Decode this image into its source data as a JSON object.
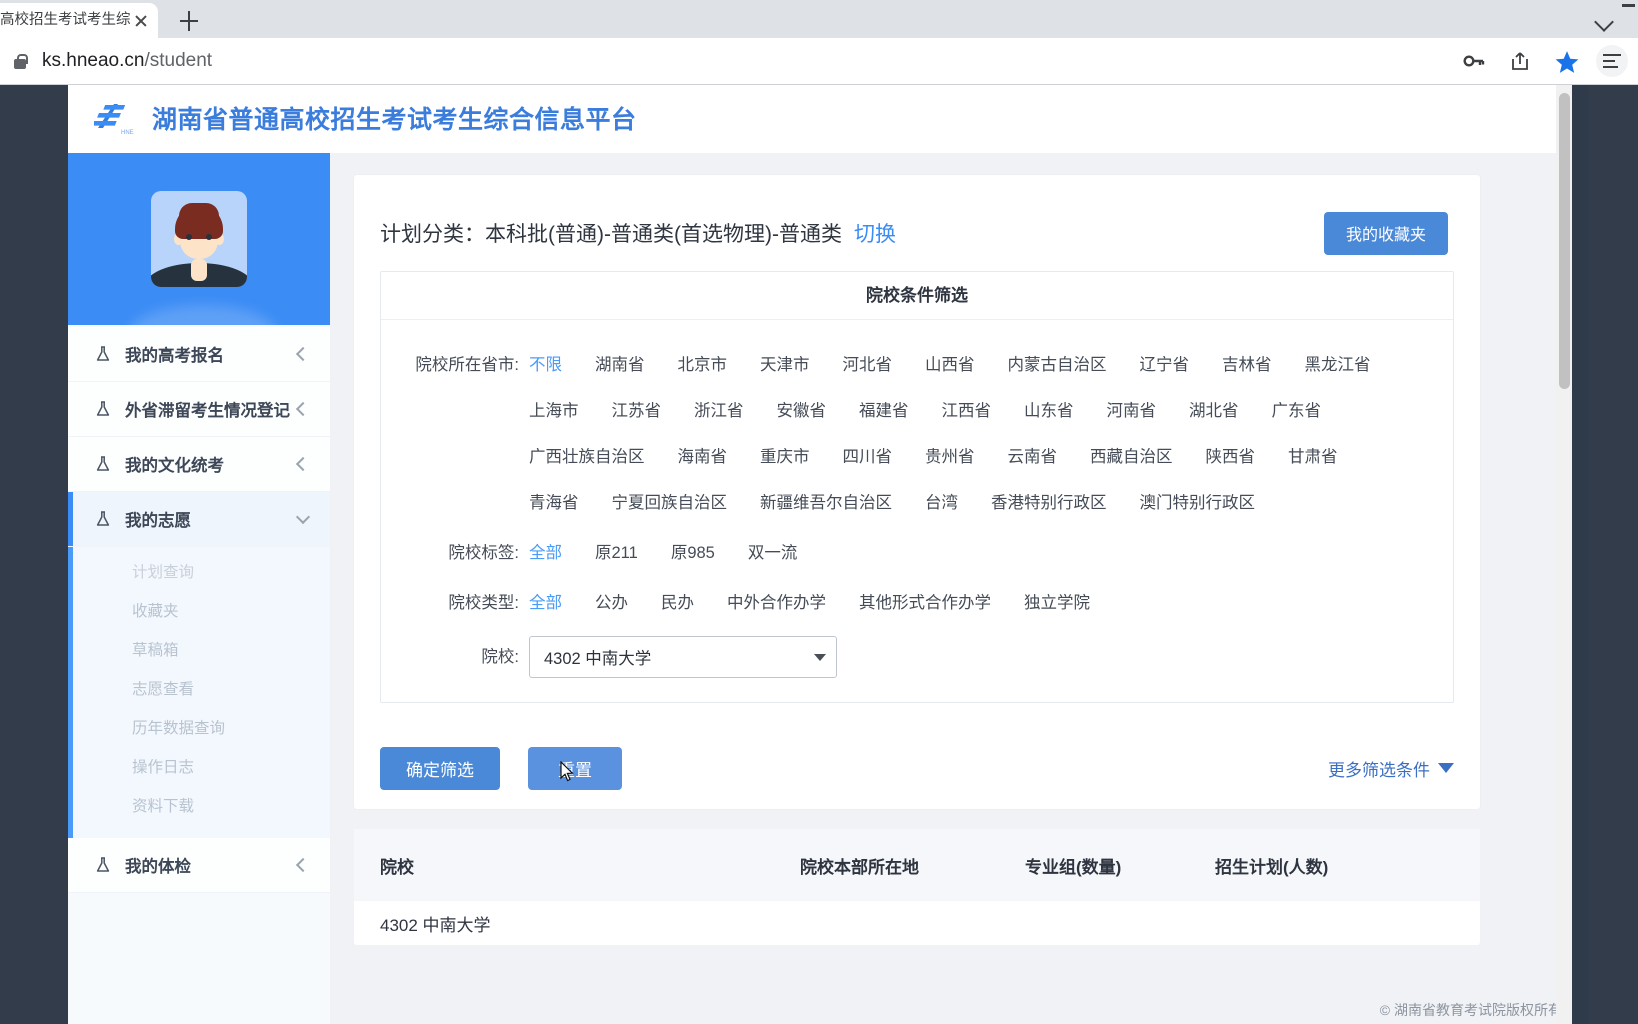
{
  "browser": {
    "tab_title": "高校招生考试考生综合",
    "url_host": "ks.hneao.cn",
    "url_path": "/student",
    "icons": {
      "lock": "lock-icon",
      "key": "key-icon",
      "share": "share-icon",
      "star": "star-icon",
      "menu": "menu-icon",
      "new_tab": "plus-icon",
      "close_tab": "close-icon"
    }
  },
  "header": {
    "site_title": "湖南省普通高校招生考试考生综合信息平台",
    "brand_color": "#3b7ddd"
  },
  "sidebar": {
    "items": [
      {
        "label": "我的高考报名",
        "expanded": false
      },
      {
        "label": "外省滞留考生情况登记",
        "expanded": false
      },
      {
        "label": "我的文化统考",
        "expanded": false
      },
      {
        "label": "我的志愿",
        "expanded": true
      },
      {
        "label": "我的体检",
        "expanded": false
      }
    ],
    "submenu": [
      {
        "label": "计划查询",
        "selected": true
      },
      {
        "label": "收藏夹",
        "selected": false
      },
      {
        "label": "草稿箱",
        "selected": false
      },
      {
        "label": "志愿查看",
        "selected": false
      },
      {
        "label": "历年数据查询",
        "selected": false
      },
      {
        "label": "操作日志",
        "selected": false
      },
      {
        "label": "资料下载",
        "selected": false
      }
    ]
  },
  "main": {
    "plan_label": "计划分类：",
    "plan_value": "本科批(普通)-普通类(首选物理)-普通类",
    "plan_switch": "切换",
    "favorites_button": "我的收藏夹",
    "filter_title": "院校条件筛选",
    "filters": [
      {
        "label": "院校所在省市:",
        "options": [
          "不限",
          "湖南省",
          "北京市",
          "天津市",
          "河北省",
          "山西省",
          "内蒙古自治区",
          "辽宁省",
          "吉林省",
          "黑龙江省",
          "上海市",
          "江苏省",
          "浙江省",
          "安徽省",
          "福建省",
          "江西省",
          "山东省",
          "河南省",
          "湖北省",
          "广东省",
          "广西壮族自治区",
          "海南省",
          "重庆市",
          "四川省",
          "贵州省",
          "云南省",
          "西藏自治区",
          "陕西省",
          "甘肃省",
          "青海省",
          "宁夏回族自治区",
          "新疆维吾尔自治区",
          "台湾",
          "香港特别行政区",
          "澳门特别行政区"
        ],
        "selected": "不限"
      },
      {
        "label": "院校标签:",
        "options": [
          "全部",
          "原211",
          "原985",
          "双一流"
        ],
        "selected": "全部"
      },
      {
        "label": "院校类型:",
        "options": [
          "全部",
          "公办",
          "民办",
          "中外合作办学",
          "其他形式合作办学",
          "独立学院"
        ],
        "selected": "全部"
      }
    ],
    "school_label": "院校:",
    "school_value": "4302 中南大学",
    "confirm_button": "确定筛选",
    "reset_button": "重置",
    "more_filters": "更多筛选条件",
    "table": {
      "columns": [
        "院校",
        "院校本部所在地",
        "专业组(数量)",
        "招生计划(人数)"
      ],
      "rows": [
        {
          "school": "4302 中南大学",
          "location": "",
          "group": "",
          "plan": ""
        }
      ]
    }
  },
  "footer": {
    "copyright": "© 湖南省教育考试院版权所有"
  },
  "colors": {
    "accent_blue": "#3b8cf5",
    "button_blue": "#4a89d8",
    "link_blue": "#4a9af8",
    "sidebar_bg": "#f7fafd",
    "page_bg": "#f0f2f5"
  }
}
